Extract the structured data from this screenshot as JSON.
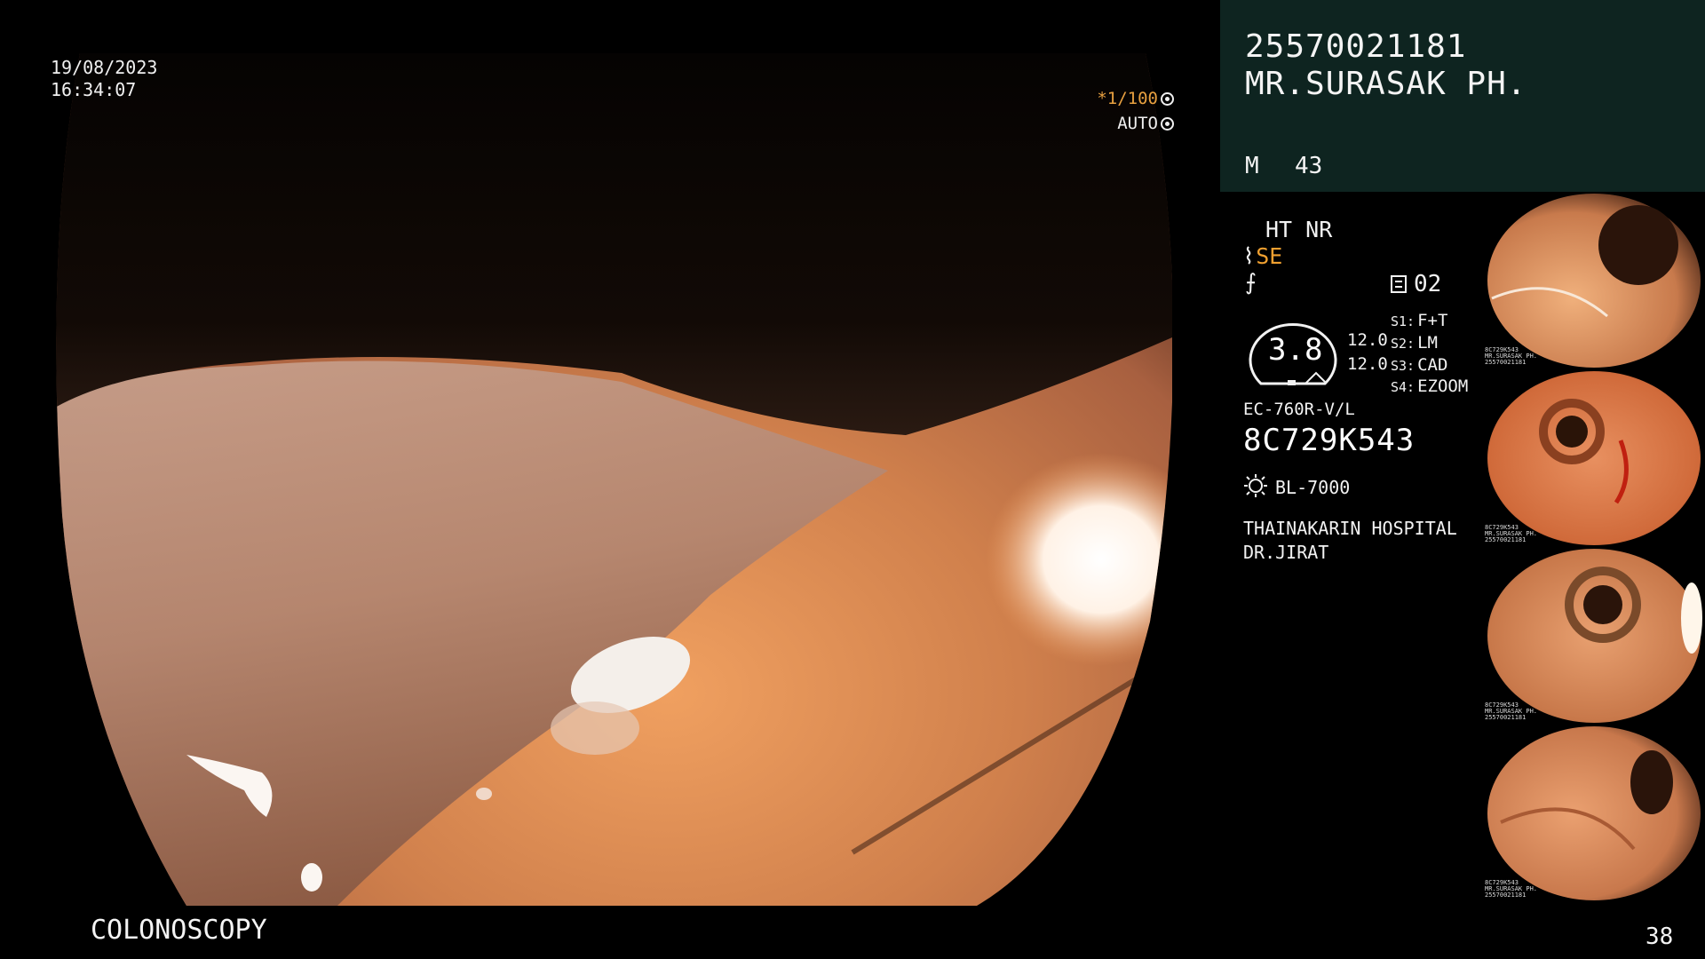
{
  "overlay": {
    "date": "19/08/2023",
    "time": "16:34:07",
    "shutter": "*1/100",
    "iris": "AUTO",
    "procedure": "COLONOSCOPY",
    "frame_count": "38"
  },
  "patient": {
    "id": "25570021181",
    "name": "MR.SURASAK PH.",
    "sex": "M",
    "age": "43"
  },
  "status": {
    "enhancement": "HT NR",
    "mode": "SE",
    "memo": "02",
    "gauge_value": "3.8",
    "gauge_a": "12.0",
    "gauge_b": "12.0",
    "switches": [
      {
        "key": "S1:",
        "value": "F+T"
      },
      {
        "key": "S2:",
        "value": "LM"
      },
      {
        "key": "S3:",
        "value": "CAD"
      },
      {
        "key": "S4:",
        "value": "EZOOM"
      }
    ],
    "scope_model": "EC-760R-V/L",
    "scope_serial": "8C729K543",
    "light_source": "BL-7000",
    "hospital": "THAINAKARIN HOSPITAL",
    "doctor": "DR.JIRAT"
  },
  "thumbnails": [
    {
      "caption_id": "8C729K543",
      "caption_name": "MR.SURASAK PH.",
      "caption_pid": "25570021181"
    },
    {
      "caption_id": "8C729K543",
      "caption_name": "MR.SURASAK PH.",
      "caption_pid": "25570021181"
    },
    {
      "caption_id": "8C729K543",
      "caption_name": "MR.SURASAK PH.",
      "caption_pid": "25570021181"
    },
    {
      "caption_id": "8C729K543",
      "caption_name": "MR.SURASAK PH.",
      "caption_pid": "25570021181"
    }
  ],
  "colors": {
    "panel_bg": "#0e2420",
    "accent_orange": "#f0a030",
    "tissue": "#e0905a"
  }
}
